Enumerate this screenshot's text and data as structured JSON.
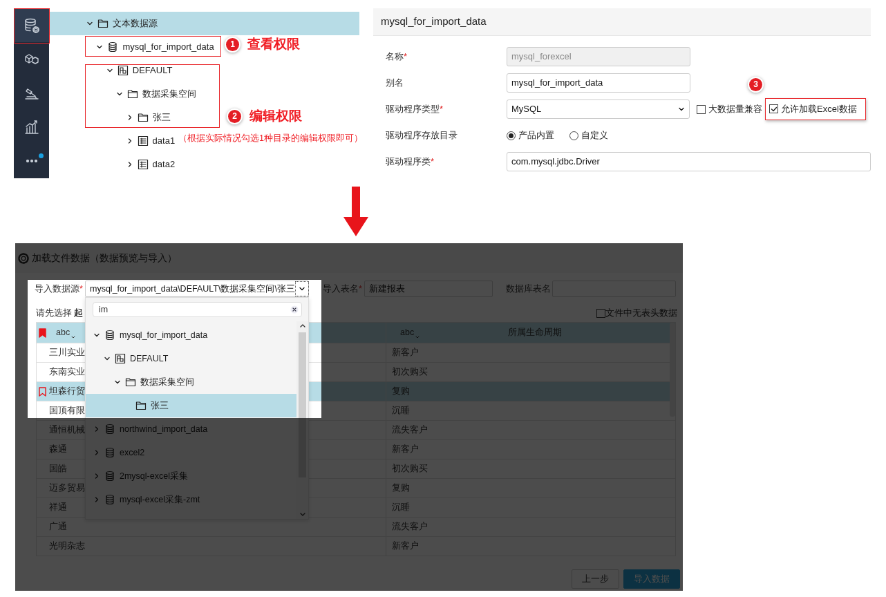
{
  "permissions": {
    "sidebar": [
      {
        "selected": true,
        "notification": false
      },
      {
        "selected": false,
        "notification": false
      },
      {
        "selected": false,
        "notification": false
      },
      {
        "selected": false,
        "notification": false
      },
      {
        "selected": false,
        "notification": true
      }
    ],
    "tree": [
      {
        "label": "文本数据源",
        "kind": "folder",
        "expanded": true,
        "selected": true,
        "children": [
          {
            "label": "mysql_for_import_data",
            "kind": "database",
            "expanded": true,
            "selected": false,
            "children": [
              {
                "label": "DEFAULT",
                "kind": "schema",
                "expanded": true,
                "selected": false,
                "children": [
                  {
                    "label": "数据采集空间",
                    "kind": "folder",
                    "expanded": true,
                    "selected": false,
                    "children": [
                      {
                        "label": "张三",
                        "kind": "folder",
                        "expanded": false,
                        "selected": false
                      },
                      {
                        "label": "data1",
                        "kind": "table",
                        "expanded": false,
                        "selected": false
                      },
                      {
                        "label": "data2",
                        "kind": "table",
                        "expanded": false,
                        "selected": false
                      }
                    ]
                  }
                ]
              }
            ]
          }
        ]
      }
    ],
    "callouts": [
      {
        "number": "1",
        "label": "查看权限"
      },
      {
        "number": "2",
        "label": "编辑权限",
        "note": "（根据实际情况勾选1种目录的编辑权限即可）"
      }
    ]
  },
  "connection_form": {
    "title": "mysql_for_import_data",
    "fields": [
      {
        "label": "名称",
        "marker": "*",
        "kind": "text",
        "value": "mysql_forexcel",
        "disabled": true
      },
      {
        "label": "别名",
        "kind": "text",
        "value": "mysql_for_import_data",
        "disabled": false
      },
      {
        "label": "驱动程序类型",
        "marker": "*",
        "kind": "select",
        "value": "MySQL",
        "checkboxes": [
          {
            "label": "大数据量兼容",
            "checked": false
          },
          {
            "label": "允许加载Excel数据",
            "checked": true,
            "callout": "3"
          }
        ]
      },
      {
        "label": "驱动程序存放目录",
        "kind": "radio",
        "options": [
          {
            "label": "产品内置",
            "selected": true
          },
          {
            "label": "自定义",
            "selected": false
          }
        ]
      },
      {
        "label": "驱动程序类",
        "marker": "*",
        "kind": "text",
        "value": "com.mysql.jdbc.Driver",
        "disabled": false
      }
    ]
  },
  "import_dialog": {
    "title": "加载文件数据（数据预览与导入）",
    "source": {
      "label": "导入数据源",
      "marker": "*",
      "value": "mysql_for_import_data\\DEFAULT\\数据采集空间\\张三"
    },
    "table_name": {
      "label": "导入表名",
      "marker": "*",
      "value": "新建报表"
    },
    "db_table_name": {
      "label": "数据库表名"
    },
    "hint": "请先选择 **起**",
    "no_header": {
      "label": "文件中无表头数据",
      "checked": false
    },
    "dropdown": {
      "search": "im",
      "tree": [
        {
          "label": "mysql_for_import_data",
          "kind": "database",
          "expandable": true,
          "expanded": true,
          "selected": false,
          "children": [
            {
              "label": "DEFAULT",
              "kind": "schema",
              "expandable": true,
              "expanded": true,
              "selected": false,
              "children": [
                {
                  "label": "数据采集空间",
                  "kind": "folder",
                  "expandable": true,
                  "expanded": true,
                  "selected": false,
                  "children": [
                    {
                      "label": "张三",
                      "kind": "folder",
                      "expandable": false,
                      "selected": true
                    }
                  ]
                }
              ]
            }
          ]
        },
        {
          "label": "northwind_import_data",
          "kind": "database",
          "expandable": true,
          "expanded": false,
          "selected": false
        },
        {
          "label": "excel2",
          "kind": "database",
          "expandable": true,
          "expanded": false,
          "selected": false
        },
        {
          "label": "2mysql-excel采集",
          "kind": "database",
          "expandable": true,
          "expanded": false,
          "selected": false
        },
        {
          "label": "mysql-excel采集-zmt",
          "kind": "database",
          "expandable": true,
          "expanded": false,
          "selected": false
        }
      ]
    },
    "table": {
      "columns": [
        {
          "type": "abc",
          "bookmarked": true
        },
        {
          "type": "abc",
          "name": "所属生命周期",
          "bookmarked": false
        }
      ],
      "rows": [
        {
          "cells": [
            "三川实业",
            "新客户"
          ],
          "selected": false,
          "bookmarked": false
        },
        {
          "cells": [
            "东南实业",
            "初次购买"
          ],
          "selected": false,
          "bookmarked": false
        },
        {
          "cells": [
            "坦森行贸",
            "复购"
          ],
          "selected": true,
          "bookmarked": true
        },
        {
          "cells": [
            "国顶有限",
            "沉睡"
          ],
          "selected": false,
          "bookmarked": false
        },
        {
          "cells": [
            "通恒机械",
            "流失客户"
          ],
          "selected": false,
          "bookmarked": false
        },
        {
          "cells": [
            "森通",
            "新客户"
          ],
          "selected": false,
          "bookmarked": false
        },
        {
          "cells": [
            "国皓",
            "初次购买"
          ],
          "selected": false,
          "bookmarked": false
        },
        {
          "cells": [
            "迈多贸易",
            "复购"
          ],
          "selected": false,
          "bookmarked": false
        },
        {
          "cells": [
            "祥通",
            "沉睡"
          ],
          "selected": false,
          "bookmarked": false
        },
        {
          "cells": [
            "广通",
            "流失客户"
          ],
          "selected": false,
          "bookmarked": false
        },
        {
          "cells": [
            "光明杂志",
            "新客户"
          ],
          "selected": false,
          "bookmarked": false
        }
      ]
    },
    "buttons": [
      {
        "label": "上一步",
        "primary": false
      },
      {
        "label": "导入数据",
        "primary": true
      }
    ]
  }
}
